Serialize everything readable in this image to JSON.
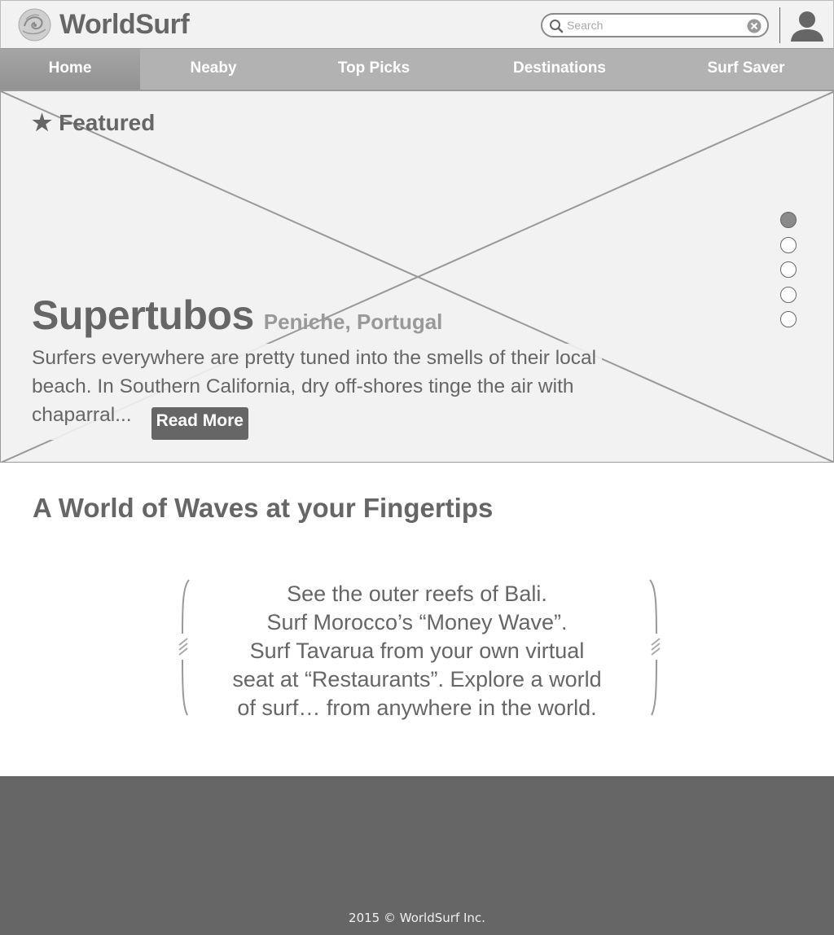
{
  "header": {
    "brand": "WorldSurf",
    "search_placeholder": "Search"
  },
  "nav": {
    "items": [
      {
        "label": "Home",
        "active": true
      },
      {
        "label": "Neaby",
        "active": false
      },
      {
        "label": "Top Picks",
        "active": false
      },
      {
        "label": "Destinations",
        "active": false
      },
      {
        "label": "Surf Saver",
        "active": false
      }
    ]
  },
  "featured": {
    "label": "Featured",
    "title": "Supertubos",
    "location": "Peniche, Portugal",
    "description": "Surfers everywhere are pretty tuned into the smells of their local beach. In Southern California, dry off-shores tinge the air with chaparral...",
    "read_more": "Read More",
    "slides": 5,
    "active_slide": 1
  },
  "section": {
    "title": "A World of Waves at your Fingertips",
    "quote_lines": [
      "See the outer reefs of Bali.",
      "Surf Morocco’s “Money Wave”.",
      "Surf Tavarua from your own virtual",
      "seat at “Restaurants”. Explore a world",
      "of surf… from anywhere in the world."
    ]
  },
  "footer": {
    "text": "2015 © WorldSurf Inc."
  },
  "colors": {
    "primary_gray": "#666666",
    "nav_bg": "#b2b2b2",
    "panel_bg": "#f2f2f2",
    "footer_bg": "#666666"
  },
  "icons": [
    "logo-icon",
    "search-icon",
    "clear-icon",
    "user-avatar-icon",
    "star-icon"
  ]
}
